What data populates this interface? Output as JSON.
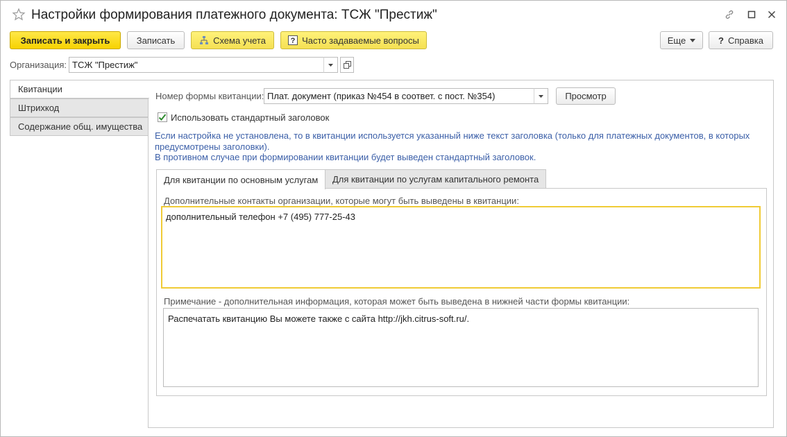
{
  "window": {
    "title": "Настройки формирования платежного документа: ТСЖ \"Престиж\""
  },
  "toolbar": {
    "save_close_label": "Записать и закрыть",
    "save_label": "Записать",
    "scheme_label": "Схема учета",
    "faq_label": "Часто задаваемые вопросы",
    "more_label": "Еще",
    "help_label": "Справка"
  },
  "organization": {
    "label": "Организация:",
    "value": "ТСЖ \"Престиж\""
  },
  "nav": {
    "items": [
      {
        "label": "Квитанции"
      },
      {
        "label": "Штрихкод"
      },
      {
        "label": "Содержание общ. имущества"
      }
    ]
  },
  "receipt": {
    "form_number_label": "Номер формы квитанции:",
    "form_number_value": "Плат. документ (приказ №454 в соответ. с пост. №354)",
    "preview_label": "Просмотр",
    "use_std_header_label": "Использовать стандартный заголовок",
    "info_line1": "Если настройка не установлена, то в квитанции используется указанный ниже текст заголовка (только для платежных документов, в которых",
    "info_line2": "предусмотрены заголовки).",
    "info_line3": "В противном случае при формировании квитанции будет выведен стандартный заголовок."
  },
  "tabs": [
    {
      "label": "Для квитанции по основным услугам"
    },
    {
      "label": "Для квитанции по услугам капитального ремонта"
    }
  ],
  "contacts": {
    "label": "Дополнительные контакты организации, которые могут быть выведены в квитанции:",
    "value": "дополнительный телефон +7 (495) 777-25-43"
  },
  "note": {
    "label": "Примечание - дополнительная информация, которая может быть выведена в нижней части формы квитанции:",
    "value": "Распечатать квитанцию Вы можете также с сайта http://jkh.citrus-soft.ru/."
  },
  "icons": {
    "star": "star-icon",
    "link": "link-icon",
    "maximize": "maximize-icon",
    "close": "close-icon",
    "scheme": "tree-icon",
    "faq": "question-icon",
    "dropdown": "chevron-down-icon",
    "open": "open-form-icon",
    "check": "check-icon"
  },
  "colors": {
    "primary_button": "#f7d200",
    "info_text": "#3b5fa8",
    "focus_border": "#f0cb36"
  }
}
